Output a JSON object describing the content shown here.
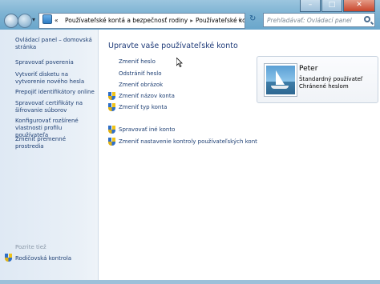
{
  "window": {
    "controls": {
      "minimize": "–",
      "maximize": "□",
      "close": "✕"
    }
  },
  "address": {
    "segments": [
      "«",
      "Používateľské kontá a bezpečnosť rodiny",
      "▸",
      "Používateľské kontá",
      "▸"
    ],
    "dropdown": "▾",
    "refresh_icon": "refresh-icon"
  },
  "search": {
    "placeholder": "Prehľadávať: Ovládací panel"
  },
  "sidebar": {
    "items": [
      {
        "label": "Ovládací panel – domovská stránka"
      },
      {
        "label": "Spravovať poverenia"
      },
      {
        "label": "Vytvoriť disketu na vytvorenie nového hesla"
      },
      {
        "label": "Prepojiť identifikátory online"
      },
      {
        "label": "Spravovať certifikáty na šifrovanie súborov"
      },
      {
        "label": "Konfigurovať rozšírené vlastnosti profilu používateľa"
      },
      {
        "label": "Zmeniť premenné prostredia"
      }
    ],
    "see_also": "Pozrite tiež",
    "parental": "Rodičovská kontrola"
  },
  "main": {
    "heading": "Upravte vaše používateľské konto",
    "tasks": [
      {
        "label": "Zmeniť heslo",
        "shield": false
      },
      {
        "label": "Odstrániť heslo",
        "shield": false
      },
      {
        "label": "Zmeniť obrázok",
        "shield": false
      },
      {
        "label": "Zmeniť názov konta",
        "shield": true
      },
      {
        "label": "Zmeniť typ konta",
        "shield": true
      },
      {
        "label": "Spravovať iné konto",
        "shield": true
      },
      {
        "label": "Zmeniť nastavenie kontroly používateľských kont",
        "shield": true
      }
    ],
    "user": {
      "name": "Peter",
      "role": "Štandardný používateľ",
      "protection": "Chránené heslom"
    }
  },
  "colors": {
    "link": "#1e3f73",
    "heading": "#1e3a78",
    "sidebar_bg": "#e6eef6"
  }
}
